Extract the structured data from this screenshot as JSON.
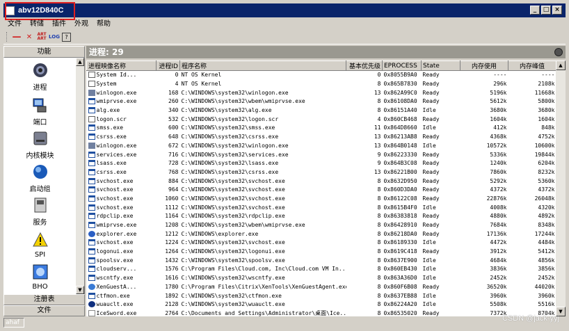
{
  "window": {
    "title": "abv12D840C"
  },
  "menu": [
    "文件",
    "转储",
    "插件",
    "外观",
    "帮助"
  ],
  "toolbar": {
    "art_label": "ART ART",
    "log_label": "LOG",
    "help_label": "?"
  },
  "left_panel": {
    "header": "功能",
    "items": [
      {
        "label": "进程",
        "icon": "gear-icon"
      },
      {
        "label": "端口",
        "icon": "network-icon"
      },
      {
        "label": "内核模块",
        "icon": "drive-icon"
      },
      {
        "label": "启动组",
        "icon": "globe-icon"
      },
      {
        "label": "服务",
        "icon": "computer-icon"
      },
      {
        "label": "SPI",
        "icon": "warning-icon"
      },
      {
        "label": "BHO",
        "icon": "ie-icon"
      }
    ],
    "footer_items": [
      "注册表",
      "文件"
    ]
  },
  "process_panel": {
    "header": "进程: 29",
    "columns": [
      "进程映像名称",
      "进程ID",
      "程序名称",
      "基本优先级",
      "EPROCESS",
      "State",
      "内存使用",
      "内存峰值"
    ],
    "rows": [
      {
        "icon": "app",
        "name": "System Id...",
        "pid": "0",
        "path": "NT OS Kernel",
        "pri": "0",
        "eprocess": "0x8055B9A0",
        "state": "Ready",
        "mem": "----",
        "peak": "----"
      },
      {
        "icon": "app",
        "name": "System",
        "pid": "4",
        "path": "NT OS Kernel",
        "pri": "8",
        "eprocess": "0x865B7830",
        "state": "Ready",
        "mem": "296k",
        "peak": "2108k"
      },
      {
        "icon": "lock",
        "name": "winlogon.exe",
        "pid": "168",
        "path": "C:\\WINDOWS\\system32\\winlogon.exe",
        "pri": "13",
        "eprocess": "0x862A99C0",
        "state": "Ready",
        "mem": "5196k",
        "peak": "11668k"
      },
      {
        "icon": "win",
        "name": "wmiprvse.exe",
        "pid": "260",
        "path": "C:\\WINDOWS\\system32\\wbem\\wmiprvse.exe",
        "pri": "8",
        "eprocess": "0x86108DA0",
        "state": "Ready",
        "mem": "5612k",
        "peak": "5800k"
      },
      {
        "icon": "win",
        "name": "alg.exe",
        "pid": "340",
        "path": "C:\\WINDOWS\\system32\\alg.exe",
        "pri": "8",
        "eprocess": "0x86151A40",
        "state": "Idle",
        "mem": "3680k",
        "peak": "3680k"
      },
      {
        "icon": "app",
        "name": "logon.scr",
        "pid": "532",
        "path": "C:\\WINDOWS\\system32\\logon.scr",
        "pri": "4",
        "eprocess": "0x860CB468",
        "state": "Ready",
        "mem": "1604k",
        "peak": "1604k"
      },
      {
        "icon": "win",
        "name": "smss.exe",
        "pid": "600",
        "path": "C:\\WINDOWS\\system32\\smss.exe",
        "pri": "11",
        "eprocess": "0x864D8660",
        "state": "Idle",
        "mem": "412k",
        "peak": "848k"
      },
      {
        "icon": "win",
        "name": "csrss.exe",
        "pid": "648",
        "path": "C:\\WINDOWS\\system32\\csrss.exe",
        "pri": "13",
        "eprocess": "0x86213AB8",
        "state": "Ready",
        "mem": "4368k",
        "peak": "4752k"
      },
      {
        "icon": "lock",
        "name": "winlogon.exe",
        "pid": "672",
        "path": "C:\\WINDOWS\\system32\\winlogon.exe",
        "pri": "13",
        "eprocess": "0x864B0148",
        "state": "Idle",
        "mem": "10572k",
        "peak": "10600k"
      },
      {
        "icon": "win",
        "name": "services.exe",
        "pid": "716",
        "path": "C:\\WINDOWS\\system32\\services.exe",
        "pri": "9",
        "eprocess": "0x86223330",
        "state": "Ready",
        "mem": "5336k",
        "peak": "19844k"
      },
      {
        "icon": "win",
        "name": "lsass.exe",
        "pid": "728",
        "path": "C:\\WINDOWS\\system32\\lsass.exe",
        "pri": "9",
        "eprocess": "0x864B3C08",
        "state": "Ready",
        "mem": "1240k",
        "peak": "6204k"
      },
      {
        "icon": "win",
        "name": "csrss.exe",
        "pid": "768",
        "path": "C:\\WINDOWS\\system32\\csrss.exe",
        "pri": "13",
        "eprocess": "0x86221B00",
        "state": "Ready",
        "mem": "7860k",
        "peak": "8232k"
      },
      {
        "icon": "win",
        "name": "svchost.exe",
        "pid": "884",
        "path": "C:\\WINDOWS\\system32\\svchost.exe",
        "pri": "8",
        "eprocess": "0x8632D950",
        "state": "Ready",
        "mem": "5292k",
        "peak": "5360k"
      },
      {
        "icon": "win",
        "name": "svchost.exe",
        "pid": "964",
        "path": "C:\\WINDOWS\\system32\\svchost.exe",
        "pri": "8",
        "eprocess": "0x860D3DA0",
        "state": "Ready",
        "mem": "4372k",
        "peak": "4372k"
      },
      {
        "icon": "win",
        "name": "svchost.exe",
        "pid": "1060",
        "path": "C:\\WINDOWS\\system32\\svchost.exe",
        "pri": "8",
        "eprocess": "0x86122C08",
        "state": "Ready",
        "mem": "22876k",
        "peak": "26048k"
      },
      {
        "icon": "win",
        "name": "svchost.exe",
        "pid": "1112",
        "path": "C:\\WINDOWS\\system32\\svchost.exe",
        "pri": "8",
        "eprocess": "0x8615B4F0",
        "state": "Idle",
        "mem": "4008k",
        "peak": "4320k"
      },
      {
        "icon": "win",
        "name": "rdpclip.exe",
        "pid": "1164",
        "path": "C:\\WINDOWS\\system32\\rdpclip.exe",
        "pri": "8",
        "eprocess": "0x86383818",
        "state": "Ready",
        "mem": "4880k",
        "peak": "4892k"
      },
      {
        "icon": "win",
        "name": "wmiprvse.exe",
        "pid": "1208",
        "path": "C:\\WINDOWS\\system32\\wbem\\wmiprvse.exe",
        "pri": "8",
        "eprocess": "0x86428910",
        "state": "Ready",
        "mem": "7684k",
        "peak": "8348k"
      },
      {
        "icon": "blue",
        "name": "explorer.exe",
        "pid": "1212",
        "path": "C:\\WINDOWS\\explorer.exe",
        "pri": "8",
        "eprocess": "0x86218DA0",
        "state": "Ready",
        "mem": "17136k",
        "peak": "17244k"
      },
      {
        "icon": "win",
        "name": "svchost.exe",
        "pid": "1224",
        "path": "C:\\WINDOWS\\system32\\svchost.exe",
        "pri": "8",
        "eprocess": "0x86189330",
        "state": "Idle",
        "mem": "4472k",
        "peak": "4484k"
      },
      {
        "icon": "win",
        "name": "logonui.exe",
        "pid": "1264",
        "path": "C:\\WINDOWS\\system32\\logonui.exe",
        "pri": "8",
        "eprocess": "0x8619C418",
        "state": "Ready",
        "mem": "3912k",
        "peak": "5412k"
      },
      {
        "icon": "win",
        "name": "spoolsv.exe",
        "pid": "1432",
        "path": "C:\\WINDOWS\\system32\\spoolsv.exe",
        "pri": "8",
        "eprocess": "0x8637E900",
        "state": "Idle",
        "mem": "4684k",
        "peak": "4856k"
      },
      {
        "icon": "win",
        "name": "cloudserv...",
        "pid": "1576",
        "path": "C:\\Program Files\\Cloud.com, Inc\\Cloud.com VM In...",
        "pri": "8",
        "eprocess": "0x860EB430",
        "state": "Idle",
        "mem": "3836k",
        "peak": "3856k"
      },
      {
        "icon": "win",
        "name": "wscntfy.exe",
        "pid": "1616",
        "path": "C:\\WINDOWS\\system32\\wscntfy.exe",
        "pri": "8",
        "eprocess": "0x863A36D0",
        "state": "Idle",
        "mem": "2452k",
        "peak": "2452k"
      },
      {
        "icon": "cloud",
        "name": "XenGuestA...",
        "pid": "1780",
        "path": "C:\\Program Files\\Citrix\\XenTools\\XenGuestAgent.exe",
        "pri": "8",
        "eprocess": "0x860F6B08",
        "state": "Ready",
        "mem": "36520k",
        "peak": "44020k"
      },
      {
        "icon": "win",
        "name": "ctfmon.exe",
        "pid": "1892",
        "path": "C:\\WINDOWS\\system32\\ctfmon.exe",
        "pri": "8",
        "eprocess": "0x8637EB88",
        "state": "Idle",
        "mem": "3960k",
        "peak": "3960k"
      },
      {
        "icon": "sym",
        "name": "wuauclt.exe",
        "pid": "2128",
        "path": "C:\\WINDOWS\\system32\\wuauclt.exe",
        "pri": "8",
        "eprocess": "0x86224A20",
        "state": "Idle",
        "mem": "5508k",
        "peak": "5516k"
      },
      {
        "icon": "icesword",
        "name": "IceSword.exe",
        "pid": "2764",
        "path": "C:\\Documents and Settings\\Administrator\\桌面\\Ice...",
        "pri": "8",
        "eprocess": "0x86535020",
        "state": "Ready",
        "mem": "7372k",
        "peak": "8704k"
      }
    ]
  },
  "status": {
    "left_text": "ahaf"
  },
  "watermark": "CSDN @jack-yyj"
}
